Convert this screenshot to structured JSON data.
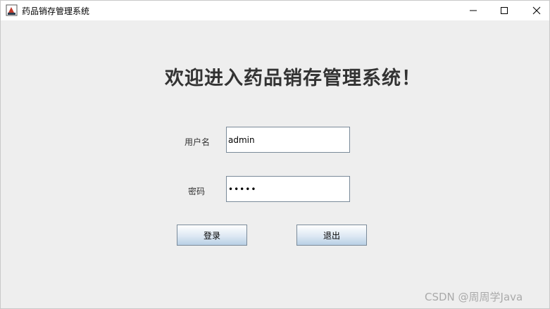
{
  "window": {
    "title": "药品销存管理系统",
    "controls": {
      "minimize": "minimize-icon",
      "maximize": "maximize-icon",
      "close": "close-icon"
    }
  },
  "main": {
    "heading": "欢迎进入药品销存管理系统！",
    "username": {
      "label": "用户名",
      "value": "admin"
    },
    "password": {
      "label": "密码",
      "value": "•••••"
    },
    "login_label": "登录",
    "exit_label": "退出"
  },
  "watermark": "CSDN @周周学Java",
  "colors": {
    "background": "#eeeeee",
    "button_gradient_end": "#b8cfe5",
    "field_border": "#7a8a99"
  }
}
